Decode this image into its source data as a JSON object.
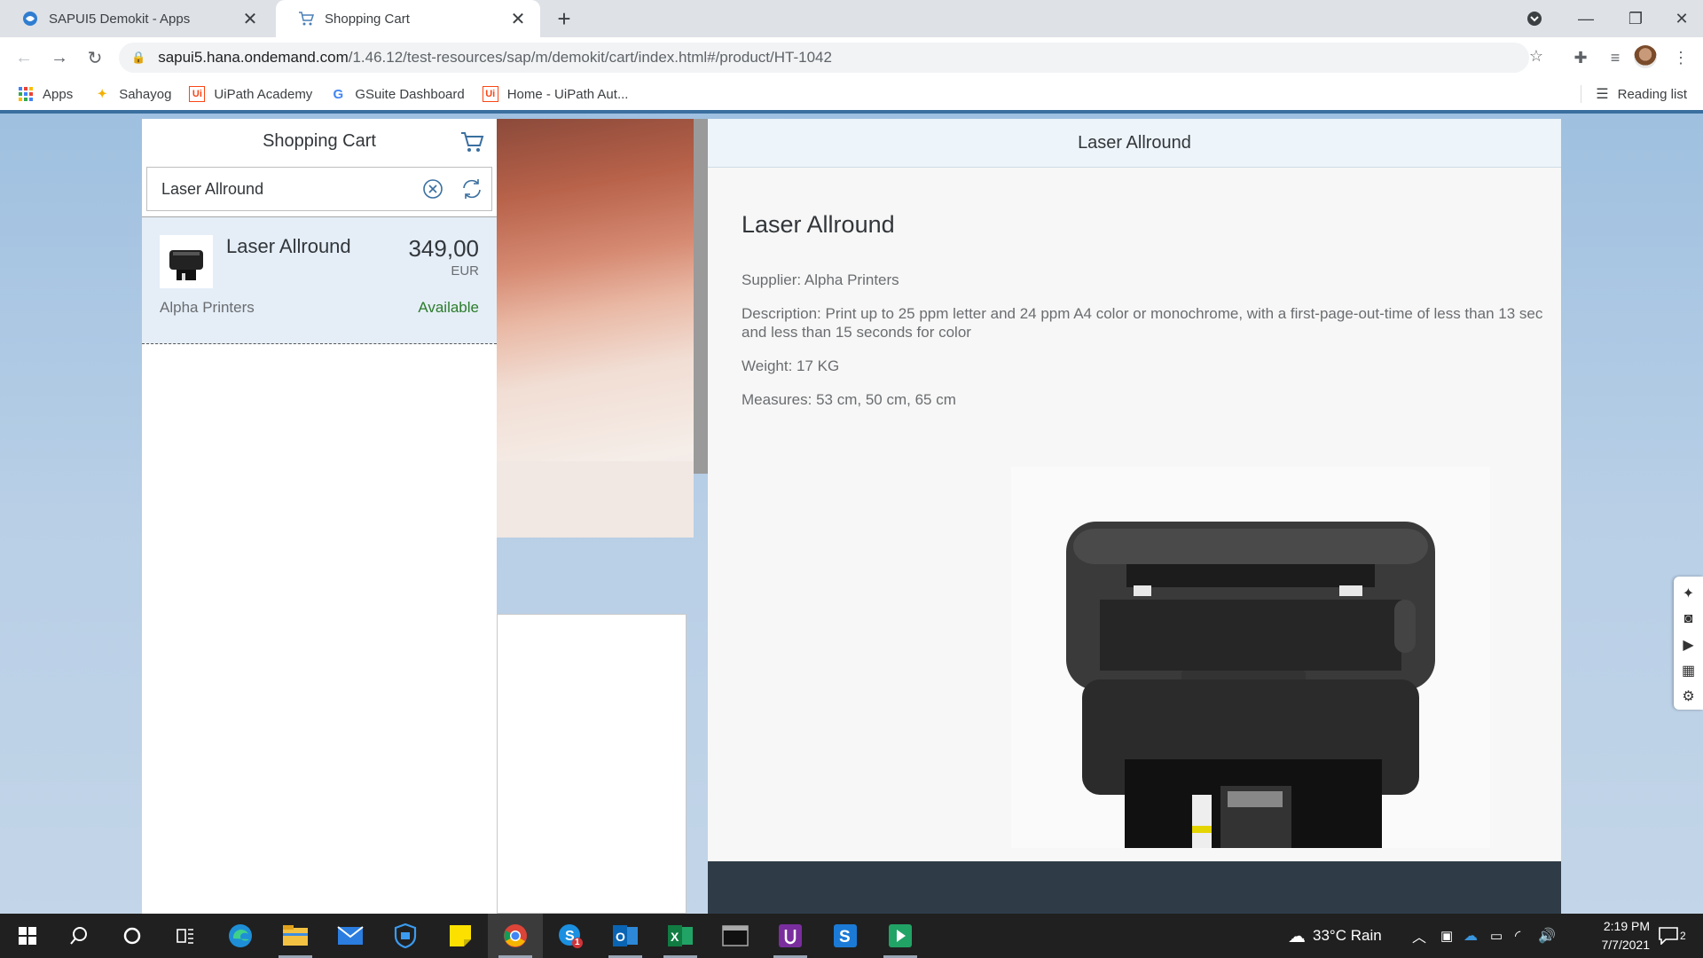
{
  "browser": {
    "tabs": [
      {
        "title": "SAPUI5 Demokit - Apps",
        "active": false
      },
      {
        "title": "Shopping Cart",
        "active": true
      }
    ],
    "url_host": "sapui5.hana.ondemand.com",
    "url_path": "/1.46.12/test-resources/sap/m/demokit/cart/index.html#/product/HT-1042",
    "bookmarks": [
      "Apps",
      "Sahayog",
      "UiPath Academy",
      "GSuite Dashboard",
      "Home - UiPath Aut..."
    ],
    "reading_list": "Reading list"
  },
  "master": {
    "title": "Shopping Cart",
    "search_value": "Laser Allround",
    "item": {
      "name": "Laser Allround",
      "price": "349,00",
      "currency": "EUR",
      "supplier": "Alpha Printers",
      "status": "Available"
    }
  },
  "detail": {
    "header": "Laser Allround",
    "title": "Laser Allround",
    "supplier": "Supplier: Alpha Printers",
    "description": "Description: Print up to 25 ppm letter and 24 ppm A4 color or monochrome, with a first-page-out-time of less than 13 sec",
    "description_cont": "and less than 15 seconds for color",
    "weight": "Weight: 17 KG",
    "measures": "Measures: 53 cm, 50 cm, 65 cm"
  },
  "taskbar": {
    "weather": "33°C  Rain",
    "time": "2:19 PM",
    "date": "7/7/2021",
    "notifications": "2",
    "skype_badge": "1"
  },
  "colors": {
    "available": "#2b7c2b",
    "shell_background": "#b8cfe6",
    "footer": "#2f3c48"
  }
}
